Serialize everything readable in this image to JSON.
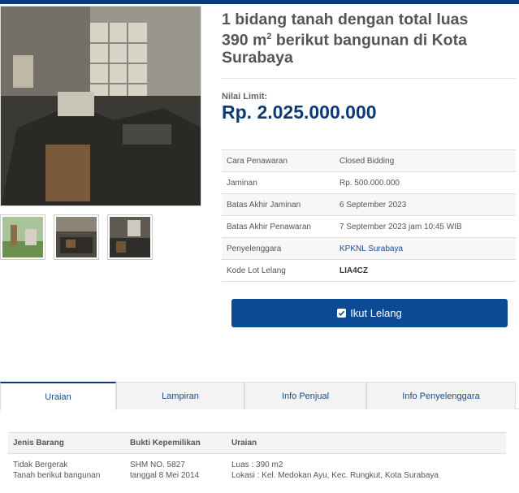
{
  "title": {
    "line1": "1 bidang tanah dengan total luas",
    "line2_pre": "390 m",
    "line2_sup": "2",
    "line2_post": " berikut bangunan di Kota",
    "line3": "Surabaya"
  },
  "limit": {
    "label": "Nilai Limit:",
    "value": "Rp. 2.025.000.000"
  },
  "info": [
    {
      "key": "Cara Penawaran",
      "value": "Closed Bidding"
    },
    {
      "key": "Jaminan",
      "value": "Rp. 500.000.000"
    },
    {
      "key": "Batas Akhir Jaminan",
      "value": "6 September 2023"
    },
    {
      "key": "Batas Akhir Penawaran",
      "value": "7 September 2023 jam 10:45 WIB"
    },
    {
      "key": "Penyelenggara",
      "value": "KPKNL Surabaya"
    },
    {
      "key": "Kode Lot Lelang",
      "value": "LIA4CZ"
    }
  ],
  "bid_button": {
    "label": "Ikut Lelang"
  },
  "tabs": [
    "Uraian",
    "Lampiran",
    "Info Penjual",
    "Info Penyelenggara"
  ],
  "detail": {
    "headers": [
      "Jenis Barang",
      "Bukti Kepemilikan",
      "Uraian"
    ],
    "row": {
      "jenis_1": "Tidak Bergerak",
      "jenis_2": "Tanah berikut bangunan",
      "bukti_1": "SHM NO. 5827",
      "bukti_2": "tanggal 8 Mei 2014",
      "uraian_1": "Luas : 390 m2",
      "uraian_2": "Lokasi : Kel. Medokan Ayu, Kec. Rungkut, Kota Surabaya"
    }
  },
  "colors": {
    "brand": "#0b3a78",
    "button": "#0d4a96"
  },
  "icons": {
    "bid": "check-square-icon"
  }
}
